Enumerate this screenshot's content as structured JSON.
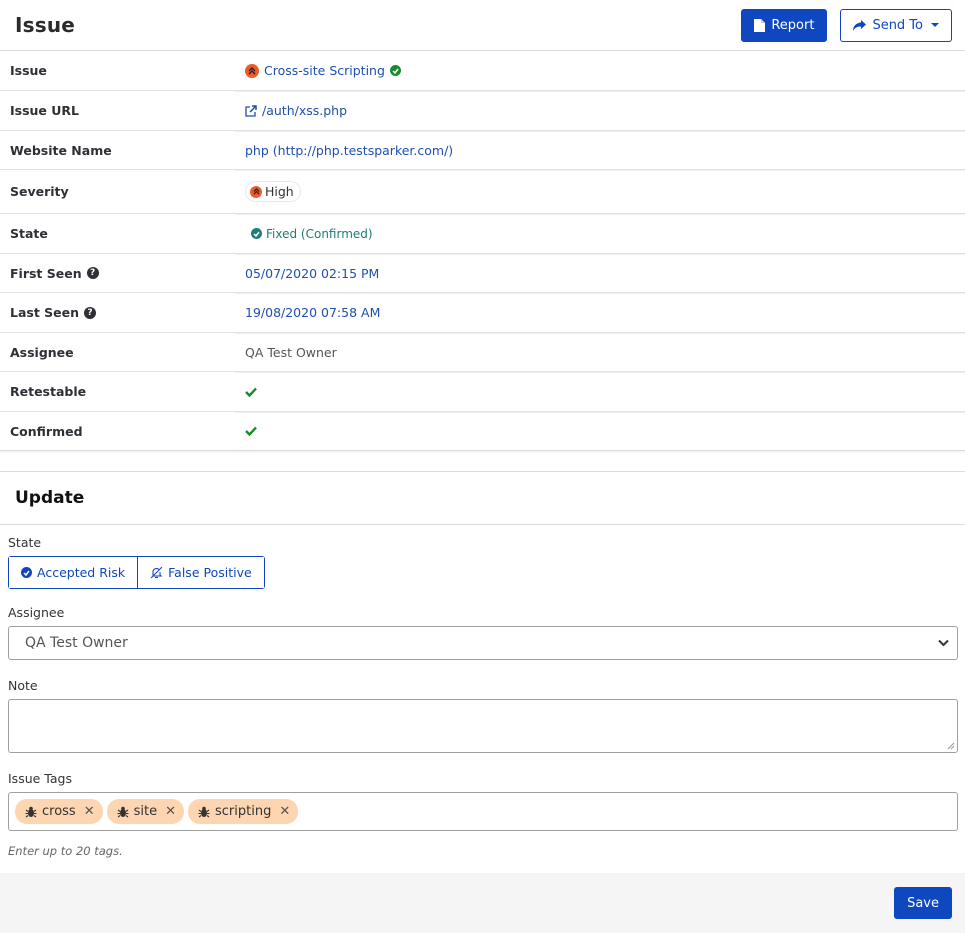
{
  "header": {
    "title": "Issue",
    "report_label": "Report",
    "send_to_label": "Send To"
  },
  "details": {
    "issue": {
      "label": "Issue",
      "value": "Cross-site Scripting"
    },
    "issue_url": {
      "label": "Issue URL",
      "value": "/auth/xss.php"
    },
    "website_name": {
      "label": "Website Name",
      "value": "php (http://php.testsparker.com/)"
    },
    "severity": {
      "label": "Severity",
      "value": "High"
    },
    "state": {
      "label": "State",
      "value": "Fixed (Confirmed)"
    },
    "first_seen": {
      "label": "First Seen",
      "value": "05/07/2020 02:15 PM"
    },
    "last_seen": {
      "label": "Last Seen",
      "value": "19/08/2020 07:58 AM"
    },
    "assignee": {
      "label": "Assignee",
      "value": "QA Test Owner"
    },
    "retestable": {
      "label": "Retestable",
      "value": true
    },
    "confirmed": {
      "label": "Confirmed",
      "value": true
    }
  },
  "update": {
    "title": "Update",
    "state_label": "State",
    "state_options": [
      "Accepted Risk",
      "False Positive"
    ],
    "assignee_label": "Assignee",
    "assignee_selected": "QA Test Owner",
    "note_label": "Note",
    "note_value": "",
    "tags_label": "Issue Tags",
    "tags": [
      "cross",
      "site",
      "scripting"
    ],
    "tags_help": "Enter up to 20 tags.",
    "save_label": "Save"
  },
  "colors": {
    "primary": "#0e47bf",
    "severity_high": "#f05a28",
    "success": "#1a8a2a",
    "fixed_state": "#1d7e74",
    "tag_bg": "#fdd5b1"
  }
}
